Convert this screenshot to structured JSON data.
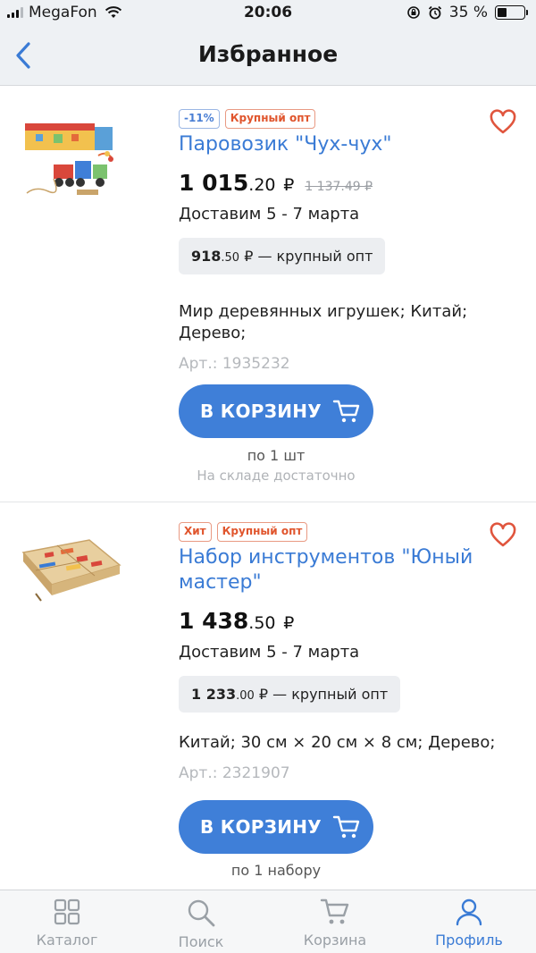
{
  "status": {
    "carrier": "MegaFon",
    "time": "20:06",
    "battery": "35 %",
    "battery_level": 0.35
  },
  "nav": {
    "title": "Избранное"
  },
  "products": [
    {
      "badges": [
        "-11%",
        "Крупный опт"
      ],
      "title": "Паровозик \"Чух-чух\"",
      "price_rub": "1 015",
      "price_kop": ".20",
      "currency": "₽",
      "old_price": "1 137.49 ₽",
      "delivery": "Доставим 5 - 7 марта",
      "wholesale_rub": "918",
      "wholesale_kop": ".50",
      "wholesale_suffix": "₽ — крупный опт",
      "specs": "Мир деревянных игрушек; Китай; Дерево;",
      "sku": "Арт.: 1935232",
      "cart_label": "В КОРЗИНУ",
      "unit": "по 1 шт",
      "stock": "На складе достаточно"
    },
    {
      "badges": [
        "Хит",
        "Крупный опт"
      ],
      "title": "Набор инструментов \"Юный мастер\"",
      "price_rub": "1 438",
      "price_kop": ".50",
      "currency": "₽",
      "delivery": "Доставим 5 - 7 марта",
      "wholesale_rub": "1 233",
      "wholesale_kop": ".00",
      "wholesale_suffix": "₽ — крупный опт",
      "specs": "Китай; 30 см × 20 см × 8 см; Дерево;",
      "sku": "Арт.: 2321907",
      "cart_label": "В КОРЗИНУ",
      "unit": "по 1 набору"
    }
  ],
  "tabs": [
    {
      "label": "Каталог",
      "icon": "grid-icon"
    },
    {
      "label": "Поиск",
      "icon": "search-icon"
    },
    {
      "label": "Корзина",
      "icon": "cart-icon"
    },
    {
      "label": "Профиль",
      "icon": "profile-icon"
    }
  ],
  "colors": {
    "accent": "#3a7bd5",
    "button": "#3f7fd8",
    "heart": "#e0553d",
    "badge_orange": "#e0552d"
  }
}
